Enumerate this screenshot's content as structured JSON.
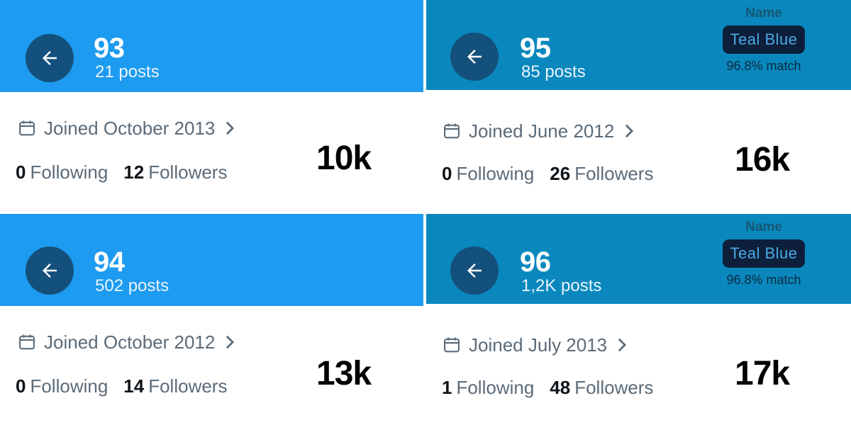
{
  "panels": [
    {
      "title": "93",
      "posts": "21 posts",
      "joined": "Joined October 2013",
      "following_count": "0",
      "following_label": "Following",
      "followers_count": "12",
      "followers_label": "Followers",
      "overlay": "10k",
      "header_color": "#1d9bf0"
    },
    {
      "title": "95",
      "posts": "85 posts",
      "name_label": "Name",
      "name_value": "Teal Blue",
      "match": "96.8% match",
      "joined": "Joined June 2012",
      "following_count": "0",
      "following_label": "Following",
      "followers_count": "26",
      "followers_label": "Followers",
      "overlay": "16k",
      "header_color": "#0a88bd"
    },
    {
      "title": "94",
      "posts": "502 posts",
      "joined": "Joined October 2012",
      "following_count": "0",
      "following_label": "Following",
      "followers_count": "14",
      "followers_label": "Followers",
      "overlay": "13k",
      "header_color": "#1d9bf0"
    },
    {
      "title": "96",
      "posts": "1,2K posts",
      "name_label": "Name",
      "name_value": "Teal Blue",
      "match": "96.8% match",
      "joined": "Joined July 2013",
      "following_count": "1",
      "following_label": "Following",
      "followers_count": "48",
      "followers_label": "Followers",
      "overlay": "17k",
      "header_color": "#0a88bd"
    }
  ],
  "icons": {
    "back": "arrow-left-icon",
    "calendar": "calendar-icon",
    "chevron": "chevron-right-icon"
  }
}
